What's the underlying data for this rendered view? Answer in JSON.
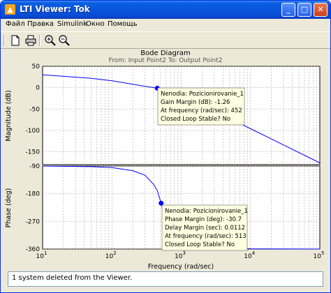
{
  "window": {
    "title": "LTI Viewer: Tok",
    "app_icon": "matlab-icon",
    "controls": {
      "minimize": "_",
      "maximize": "□",
      "close": "✕"
    }
  },
  "menu": [
    {
      "label": "Файл"
    },
    {
      "label": "Правка"
    },
    {
      "label": "Simulink"
    },
    {
      "label": "Окно"
    },
    {
      "label": "Помощь"
    }
  ],
  "toolbar": {
    "tools": [
      "new-file-icon",
      "print-icon",
      "zoom-in-icon",
      "zoom-out-icon"
    ]
  },
  "plot": {
    "title": "Bode Diagram",
    "subtitle": "From: Input Point2  To: Output Point2",
    "xlabel": "Frequency  (rad/sec)",
    "mag_ylabel": "Magnitude (dB)",
    "phase_ylabel": "Phase (deg)",
    "mag_ticks": [
      "50",
      "0",
      "-50",
      "-100",
      "-150"
    ],
    "phase_ticks": [
      "-90",
      "-180",
      "-270",
      "-360"
    ],
    "x_ticks": [
      {
        "base": "10",
        "exp": "1"
      },
      {
        "base": "10",
        "exp": "2"
      },
      {
        "base": "10",
        "exp": "3"
      },
      {
        "base": "10",
        "exp": "4"
      },
      {
        "base": "10",
        "exp": "5"
      }
    ],
    "gain_tip": [
      "Nenodia: Pozicionirovanie_1",
      "Gain Margin (dB): -1.26",
      "At frequency (rad/sec): 452",
      "Closed Loop Stable? No"
    ],
    "phase_tip": [
      "Nenodia: Pozicionirovanie_1",
      "Phase Margin (deg): -30.7",
      "Delay Margin (sec): 0.0112",
      "At frequency (rad/sec): 513",
      "Closed Loop Stable? No"
    ]
  },
  "chart_data": [
    {
      "type": "line",
      "title": "Bode Diagram",
      "subtitle": "From: Input Point2  To: Output Point2",
      "xlabel": "Frequency  (rad/sec)",
      "ylabel": "Magnitude (dB)",
      "xscale": "log",
      "xlim": [
        10,
        100000
      ],
      "ylim": [
        -180,
        50
      ],
      "grid": true,
      "x": [
        10,
        50,
        100,
        200,
        300,
        452,
        700,
        1000,
        2000,
        5000,
        10000,
        30000,
        100000
      ],
      "series": [
        {
          "values": [
            30,
            22,
            16,
            8,
            3,
            -1.26,
            -8,
            -17,
            -40,
            -72,
            -96,
            -134,
            -176
          ]
        }
      ],
      "markers": [
        {
          "x": 452,
          "y": -1.26
        }
      ]
    },
    {
      "type": "line",
      "xlabel": "Frequency  (rad/sec)",
      "ylabel": "Phase (deg)",
      "xscale": "log",
      "xlim": [
        10,
        100000
      ],
      "ylim": [
        -360,
        -90
      ],
      "grid": true,
      "x": [
        10,
        50,
        100,
        200,
        300,
        400,
        452,
        513,
        600,
        800,
        1000,
        3000,
        10000,
        100000
      ],
      "series": [
        {
          "values": [
            -90,
            -92,
            -95,
            -105,
            -120,
            -150,
            -170,
            -210,
            -280,
            -340,
            -350,
            -356,
            -359,
            -360
          ]
        }
      ],
      "markers": [
        {
          "x": 513,
          "y": -210.7
        }
      ]
    }
  ],
  "status": {
    "text": "1 system deleted from the Viewer."
  },
  "colors": {
    "line": "#0000ff",
    "tip_bg": "#ffffe1",
    "titlebar": "#0855dd"
  }
}
